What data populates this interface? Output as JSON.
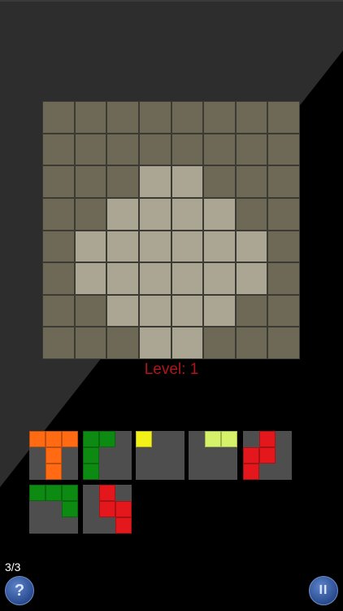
{
  "level_label": "Level: 1",
  "counter": "3/3",
  "help_label": "?",
  "pause_label": "II",
  "colors": {
    "board_empty": "#6e6857",
    "board_target": "#aba593",
    "level_text": "#b0151b",
    "piece_bg": "#4e4e4e",
    "orange": "#ff6a13",
    "green": "#0d8a12",
    "yellow": "#f2f218",
    "lime": "#d5f26a",
    "red": "#e3171c"
  },
  "board": {
    "size": 8,
    "rows": [
      "00000000",
      "00000000",
      "00011000",
      "00111100",
      "01111110",
      "01111110",
      "00111100",
      "00011000"
    ]
  },
  "pieces": [
    {
      "name": "orange-t",
      "color": "orange",
      "cells": [
        [
          0,
          0
        ],
        [
          0,
          1
        ],
        [
          0,
          2
        ],
        [
          1,
          1
        ],
        [
          2,
          1
        ]
      ]
    },
    {
      "name": "green-l",
      "color": "green",
      "cells": [
        [
          0,
          0
        ],
        [
          0,
          1
        ],
        [
          1,
          0
        ],
        [
          2,
          0
        ]
      ]
    },
    {
      "name": "yellow-single",
      "color": "yellow",
      "cells": [
        [
          0,
          0
        ]
      ]
    },
    {
      "name": "lime-domino",
      "color": "lime",
      "cells": [
        [
          0,
          1
        ],
        [
          0,
          2
        ]
      ]
    },
    {
      "name": "red-s",
      "color": "red",
      "cells": [
        [
          0,
          1
        ],
        [
          1,
          0
        ],
        [
          1,
          1
        ],
        [
          2,
          0
        ]
      ]
    },
    {
      "name": "green-j",
      "color": "green",
      "cells": [
        [
          0,
          0
        ],
        [
          0,
          1
        ],
        [
          0,
          2
        ],
        [
          1,
          2
        ]
      ]
    },
    {
      "name": "red-z",
      "color": "red",
      "cells": [
        [
          0,
          1
        ],
        [
          1,
          1
        ],
        [
          1,
          2
        ],
        [
          2,
          2
        ]
      ]
    }
  ]
}
